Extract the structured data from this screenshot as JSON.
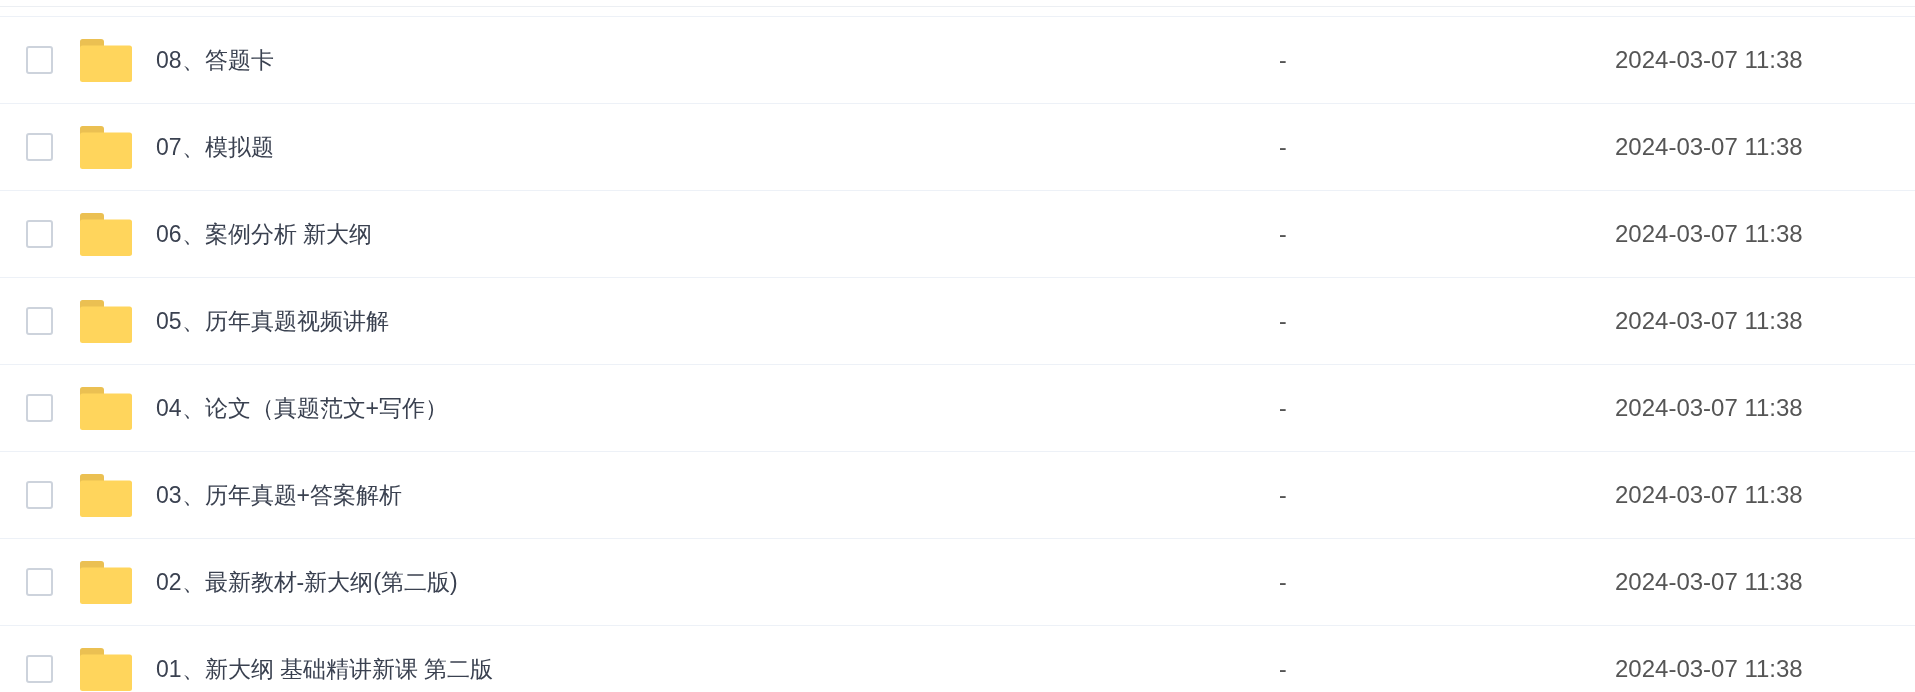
{
  "rows": [
    {
      "name": "08、答题卡",
      "column_3": "-",
      "time": "2024-03-07 11:38",
      "checked": false
    },
    {
      "name": "07、模拟题",
      "column_3": "-",
      "time": "2024-03-07 11:38",
      "checked": false
    },
    {
      "name": "06、案例分析 新大纲",
      "column_3": "-",
      "time": "2024-03-07 11:38",
      "checked": false
    },
    {
      "name": "05、历年真题视频讲解",
      "column_3": "-",
      "time": "2024-03-07 11:38",
      "checked": false
    },
    {
      "name": "04、论文（真题范文+写作）",
      "column_3": "-",
      "time": "2024-03-07 11:38",
      "checked": false
    },
    {
      "name": "03、历年真题+答案解析",
      "column_3": "-",
      "time": "2024-03-07 11:38",
      "checked": false
    },
    {
      "name": "02、最新教材-新大纲(第二版)",
      "column_3": "-",
      "time": "2024-03-07 11:38",
      "checked": false
    },
    {
      "name": "01、新大纲 基础精讲新课 第二版",
      "column_3": "-",
      "time": "2024-03-07 11:38",
      "checked": false
    }
  ]
}
